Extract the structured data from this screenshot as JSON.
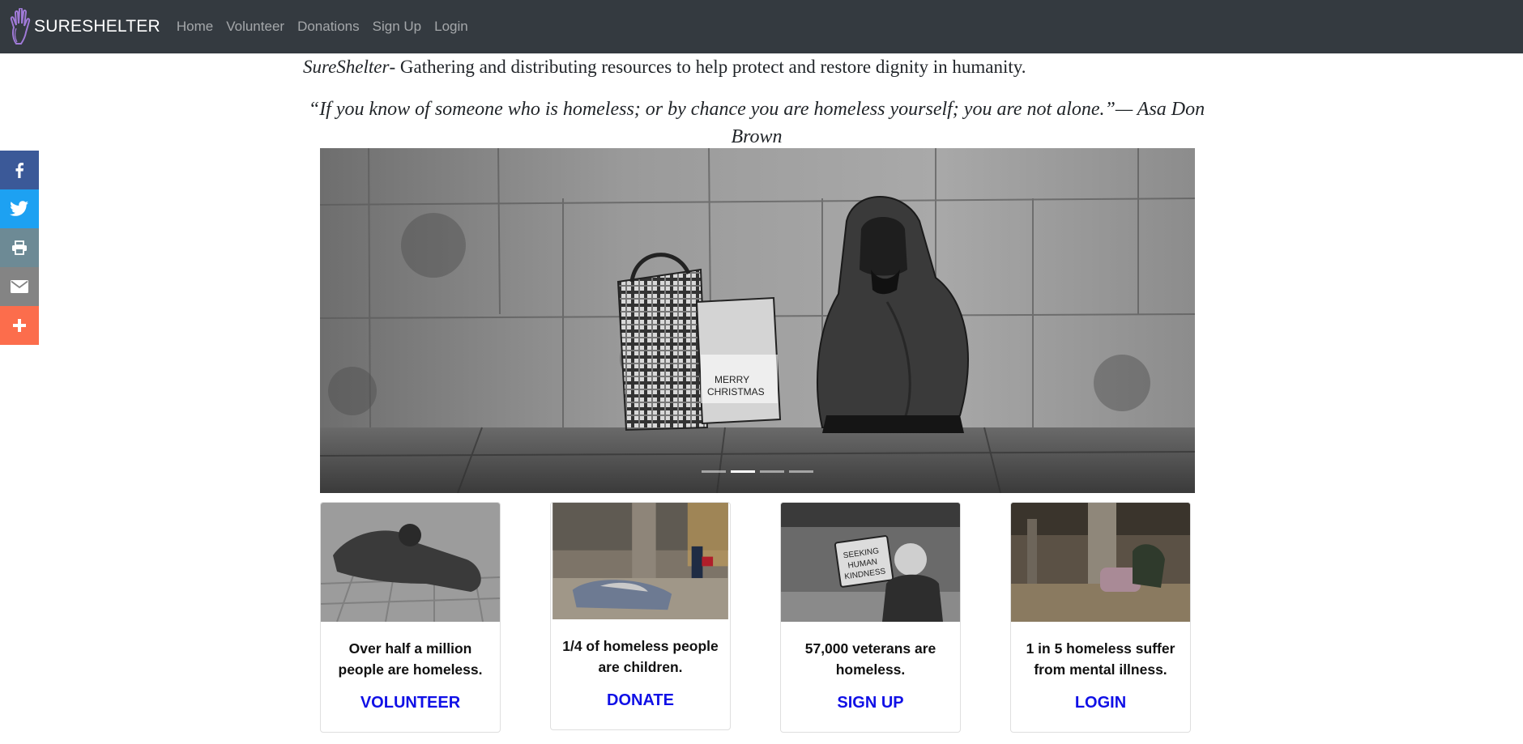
{
  "nav": {
    "brand": "SURESHELTER",
    "links": [
      "Home",
      "Volunteer",
      "Donations",
      "Sign Up",
      "Login"
    ]
  },
  "intro": {
    "brand_italic": "SureShelter",
    "text": "- Gathering and distributing resources to help protect and restore dignity in humanity."
  },
  "quote": {
    "text": "“If you know of someone who is homeless; or by chance you are homeless yourself; you are not alone.”— Asa Don Brown"
  },
  "share": {
    "buttons": [
      {
        "icon": "facebook-icon",
        "color": "#3b5998"
      },
      {
        "icon": "twitter-icon",
        "color": "#1da1f2"
      },
      {
        "icon": "print-icon",
        "color": "#6d8a95"
      },
      {
        "icon": "email-icon",
        "color": "#848484"
      },
      {
        "icon": "plus-icon",
        "color": "#fc6d4c"
      }
    ]
  },
  "carousel": {
    "slide_count": 4,
    "active_index": 1
  },
  "cards": [
    {
      "text": "Over half a million people are homeless.",
      "link": "VOLUNTEER"
    },
    {
      "text": "1/4 of homeless people are children.",
      "link": "DONATE"
    },
    {
      "text": "57,000 veterans are homeless.",
      "link": "SIGN UP"
    },
    {
      "text": "1 in 5 homeless suffer from mental illness.",
      "link": "LOGIN"
    }
  ],
  "colors": {
    "navbar": "#343a40",
    "link": "#1010e6",
    "logo": "#a07ad8"
  }
}
